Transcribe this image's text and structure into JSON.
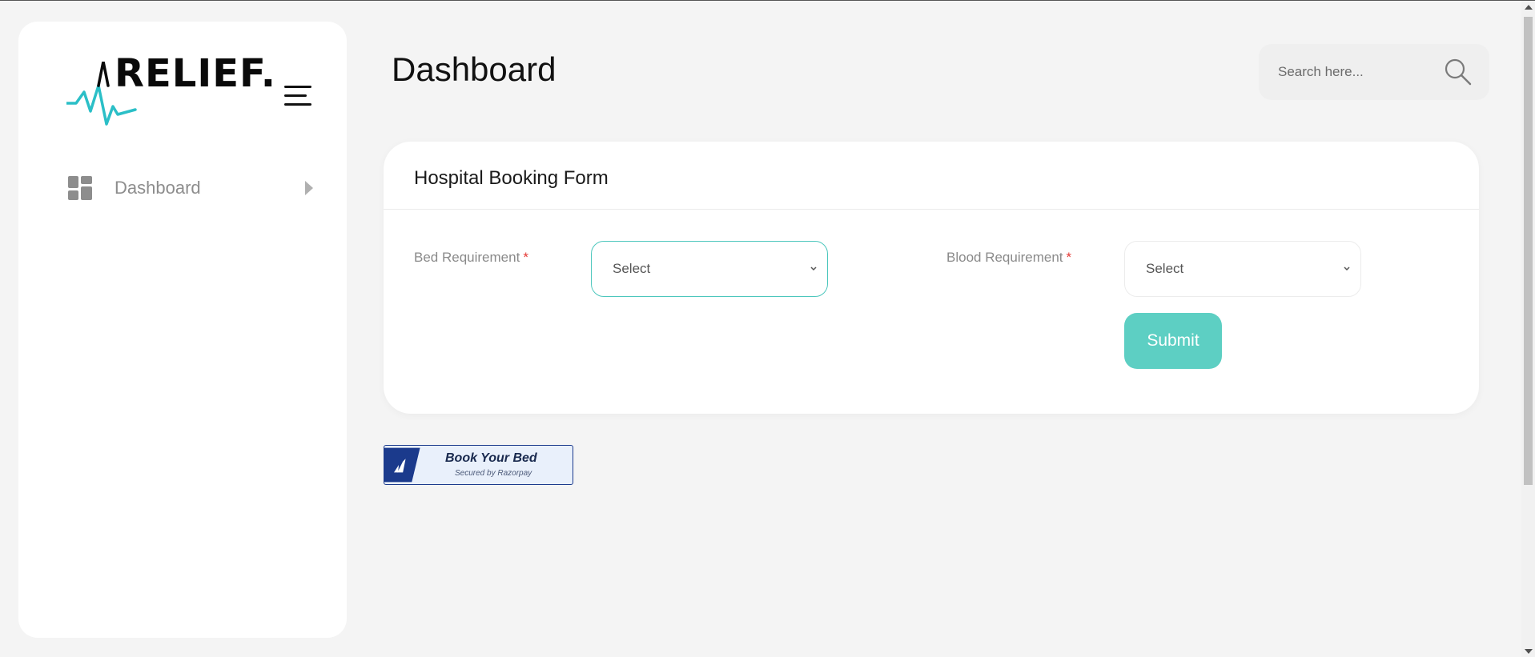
{
  "brand": {
    "name": "RELIEF.",
    "accent_color": "#2bbfc7"
  },
  "sidebar": {
    "items": [
      {
        "label": "Dashboard",
        "icon": "dashboard-grid-icon"
      }
    ]
  },
  "header": {
    "title": "Dashboard",
    "search_placeholder": "Search here..."
  },
  "form": {
    "title": "Hospital Booking Form",
    "bed": {
      "label": "Bed Requirement",
      "required_mark": "*",
      "value": "Select"
    },
    "blood": {
      "label": "Blood Requirement",
      "required_mark": "*",
      "value": "Select"
    },
    "submit_label": "Submit",
    "submit_color": "#5dcfc3"
  },
  "payment_button": {
    "title": "Book Your Bed",
    "subtitle": "Secured by Razorpay",
    "brand_color": "#1b3a8c"
  }
}
